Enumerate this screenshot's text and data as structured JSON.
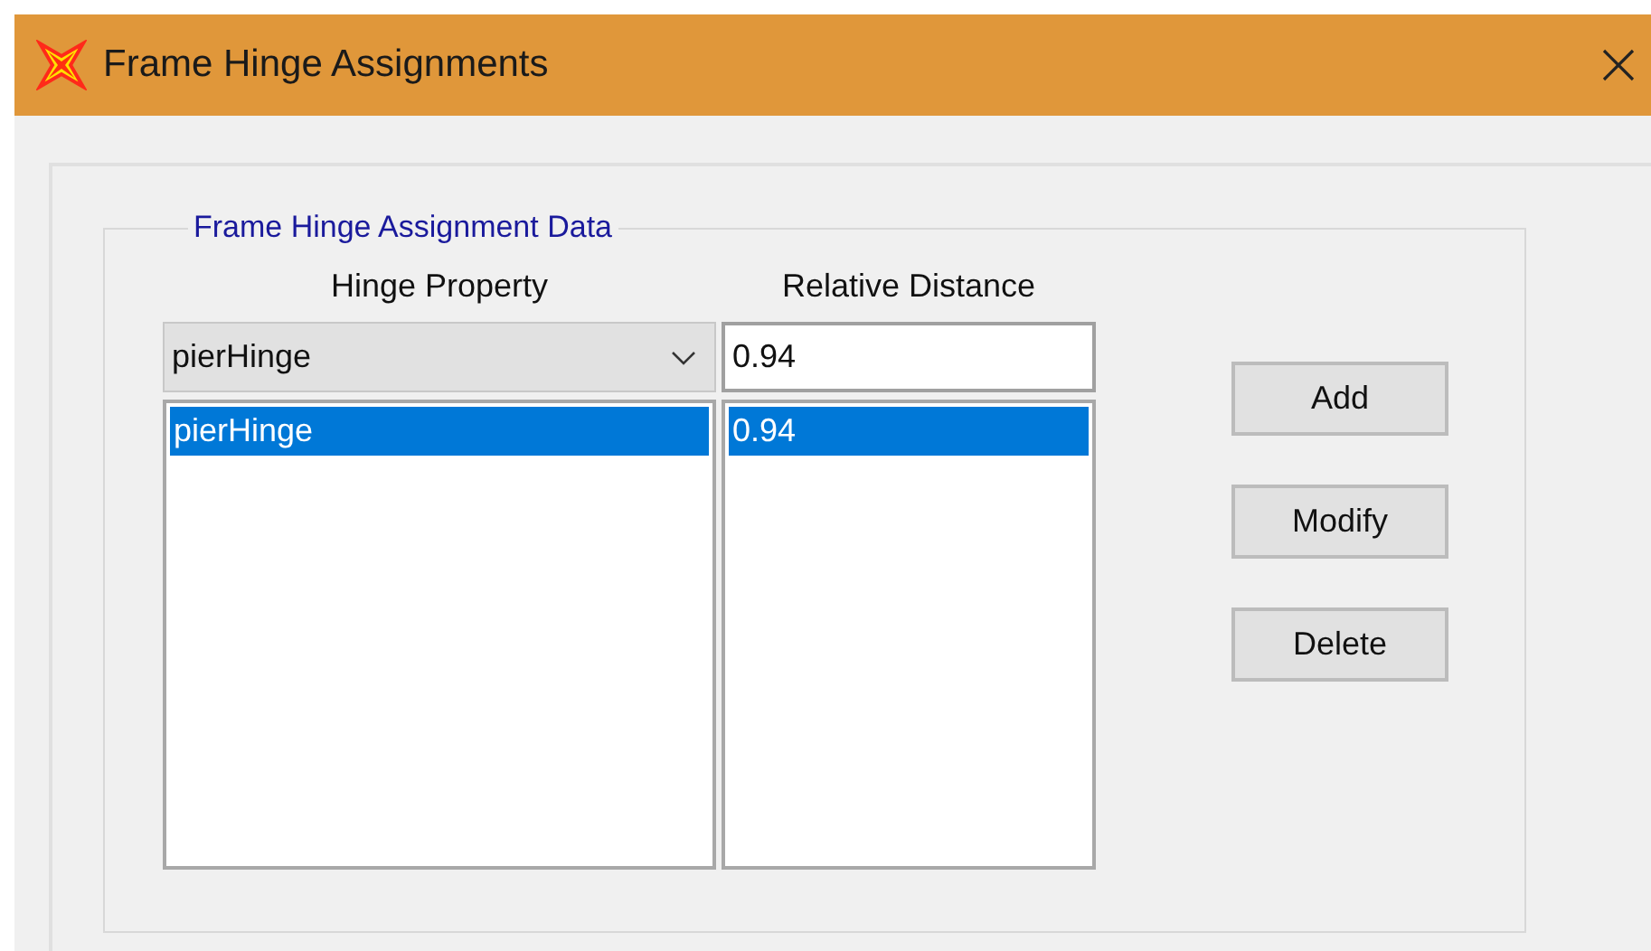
{
  "window": {
    "title": "Frame Hinge Assignments"
  },
  "group": {
    "title": "Frame Hinge Assignment Data",
    "columns": [
      "Hinge Property",
      "Relative Distance"
    ],
    "property_dropdown": {
      "value": "pierHinge"
    },
    "distance_field": {
      "value": "0.94"
    },
    "rows": [
      {
        "property": "pierHinge",
        "distance": "0.94",
        "selected": true
      }
    ],
    "buttons": [
      "Add",
      "Modify",
      "Delete"
    ]
  }
}
